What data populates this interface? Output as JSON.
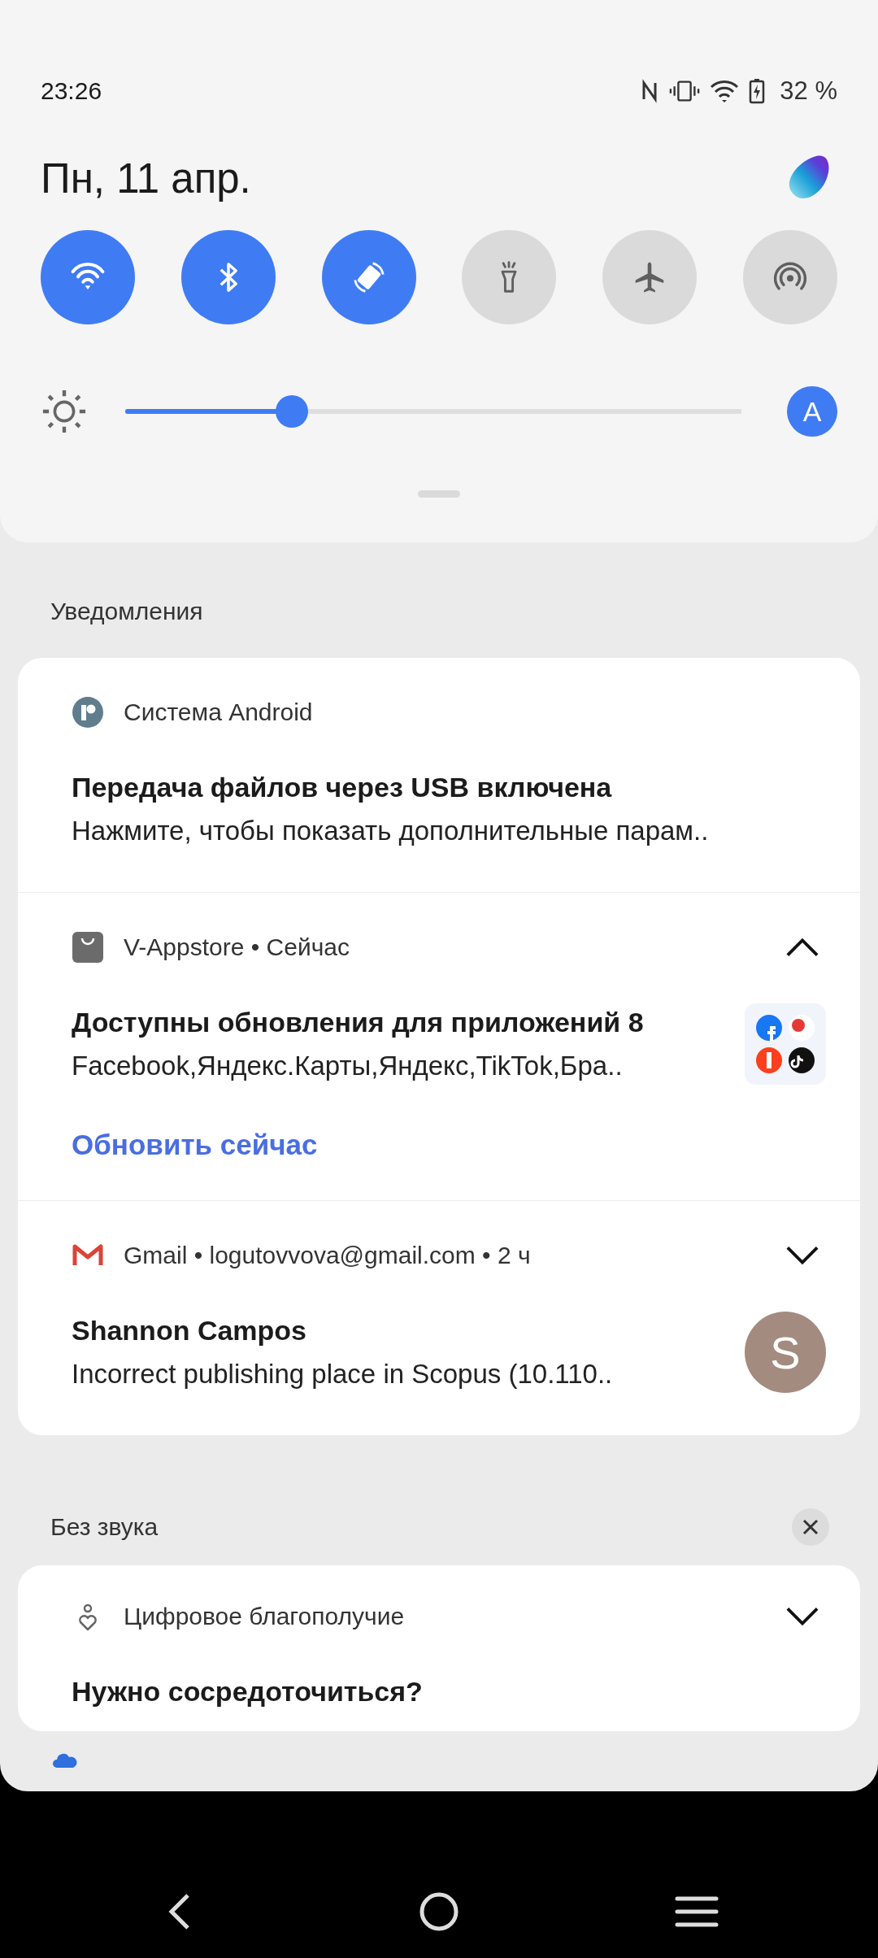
{
  "status_bar": {
    "time": "23:26",
    "battery": "32 %"
  },
  "date": "Пн, 11 апр.",
  "tiles": [
    {
      "kind": "wifi",
      "on": true
    },
    {
      "kind": "bluetooth",
      "on": true
    },
    {
      "kind": "rotate",
      "on": true
    },
    {
      "kind": "flashlight",
      "on": false
    },
    {
      "kind": "airplane",
      "on": false
    },
    {
      "kind": "hotspot",
      "on": false
    }
  ],
  "brightness": {
    "level": 0.27,
    "auto_label": "A",
    "auto": true
  },
  "notifications_header": "Уведомления",
  "notifications": [
    {
      "kind": "android",
      "header": "Система Android",
      "title": "Передача файлов через USB включена",
      "text": "Нажмите, чтобы показать дополнительные парам.."
    },
    {
      "kind": "store",
      "header": "V-Appstore • Сейчас",
      "expanded": true,
      "title": "Доступны обновления для приложений 8",
      "text": "Facebook,Яндекс.Карты,Яндекс,TikTok,Бра..",
      "attachment": {
        "kind": "app-grid"
      },
      "action": "Обновить сейчас"
    },
    {
      "kind": "gmail",
      "header": "Gmail • logutovvova@gmail.com • 2 ч",
      "expanded": false,
      "title": "Shannon Campos",
      "text": "Incorrect publishing place in Scopus (10.110..",
      "attachment": {
        "kind": "avatar",
        "letter": "S"
      }
    }
  ],
  "silent_header": "Без звука",
  "silent_notifications": [
    {
      "kind": "wellbeing",
      "header": "Цифровое благополучие",
      "expanded": false,
      "title": "Нужно сосредоточиться?"
    }
  ]
}
